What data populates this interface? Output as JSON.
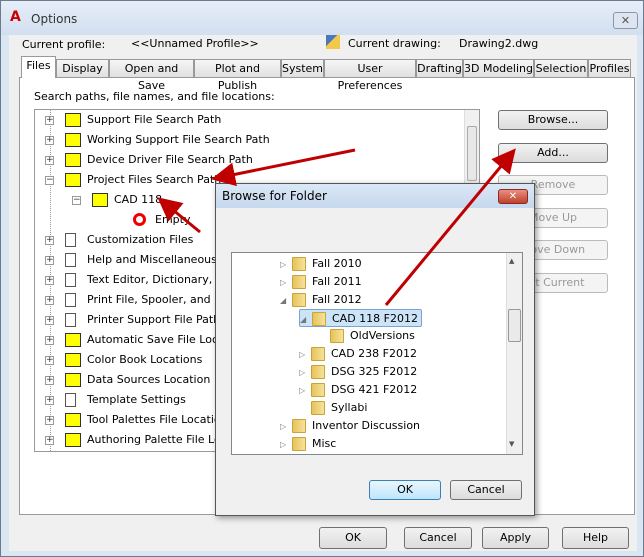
{
  "window": {
    "title": "Options",
    "close": "✕"
  },
  "profile": {
    "label": "Current profile:",
    "value": "<<Unnamed Profile>>",
    "drawing_label": "Current drawing:",
    "drawing_value": "Drawing2.dwg"
  },
  "tabs": [
    "Files",
    "Display",
    "Open and Save",
    "Plot and Publish",
    "System",
    "User Preferences",
    "Drafting",
    "3D Modeling",
    "Selection",
    "Profiles"
  ],
  "files": {
    "heading": "Search paths, file names, and file locations:",
    "tree": [
      {
        "label": "Support File Search Path",
        "icon": "folder-stack-icon"
      },
      {
        "label": "Working Support File Search Path",
        "icon": "folder-stack-icon"
      },
      {
        "label": "Device Driver File Search Path",
        "icon": "folder-stack-icon"
      },
      {
        "label": "Project Files Search Path",
        "icon": "project-icon",
        "expanded": true
      },
      {
        "label": "CAD 118",
        "icon": "open-folder-icon",
        "level": 1,
        "expanded": true
      },
      {
        "label": "Empty",
        "icon": "no-entry-icon",
        "level": 2
      },
      {
        "label": "Customization Files",
        "icon": "document-stack-icon"
      },
      {
        "label": "Help and Miscellaneous File Names",
        "icon": "document-stack-icon"
      },
      {
        "label": "Text Editor, Dictionary, and Font File Names",
        "icon": "document-stack-icon"
      },
      {
        "label": "Print File, Spooler, and Prolog Section Names",
        "icon": "document-stack-icon"
      },
      {
        "label": "Printer Support File Path",
        "icon": "document-stack-icon"
      },
      {
        "label": "Automatic Save File Location",
        "icon": "folder-stack-icon"
      },
      {
        "label": "Color Book Locations",
        "icon": "folder-stack-icon"
      },
      {
        "label": "Data Sources Location",
        "icon": "folder-stack-icon"
      },
      {
        "label": "Template Settings",
        "icon": "document-stack-icon"
      },
      {
        "label": "Tool Palettes File Locations",
        "icon": "folder-stack-icon"
      },
      {
        "label": "Authoring Palette File Locations",
        "icon": "folder-stack-icon"
      }
    ],
    "buttons": {
      "browse": "Browse...",
      "add": "Add...",
      "remove": "Remove",
      "move_up": "Move Up",
      "move_down": "Move Down",
      "set_current": "Set Current"
    }
  },
  "footer": {
    "ok": "OK",
    "cancel": "Cancel",
    "apply": "Apply",
    "help": "Help"
  },
  "browse_dialog": {
    "title": "Browse for Folder",
    "close": "✕",
    "folders": [
      {
        "label": "Fall 2010",
        "level": 0,
        "expander": "collapsed"
      },
      {
        "label": "Fall 2011",
        "level": 0,
        "expander": "collapsed"
      },
      {
        "label": "Fall 2012",
        "level": 0,
        "expander": "expanded"
      },
      {
        "label": "CAD 118 F2012",
        "level": 1,
        "expander": "expanded",
        "selected": true
      },
      {
        "label": "OldVersions",
        "level": 2,
        "expander": "none"
      },
      {
        "label": "CAD 238 F2012",
        "level": 1,
        "expander": "collapsed"
      },
      {
        "label": "DSG 325 F2012",
        "level": 1,
        "expander": "collapsed"
      },
      {
        "label": "DSG 421 F2012",
        "level": 1,
        "expander": "collapsed"
      },
      {
        "label": "Syllabi",
        "level": 1,
        "expander": "none"
      },
      {
        "label": "Inventor Discussion",
        "level": 0,
        "expander": "collapsed"
      },
      {
        "label": "Misc",
        "level": 0,
        "expander": "collapsed"
      }
    ],
    "ok": "OK",
    "cancel": "Cancel"
  },
  "colors": {
    "annotation_arrow": "#c00000",
    "selection": "#cce4f7"
  }
}
